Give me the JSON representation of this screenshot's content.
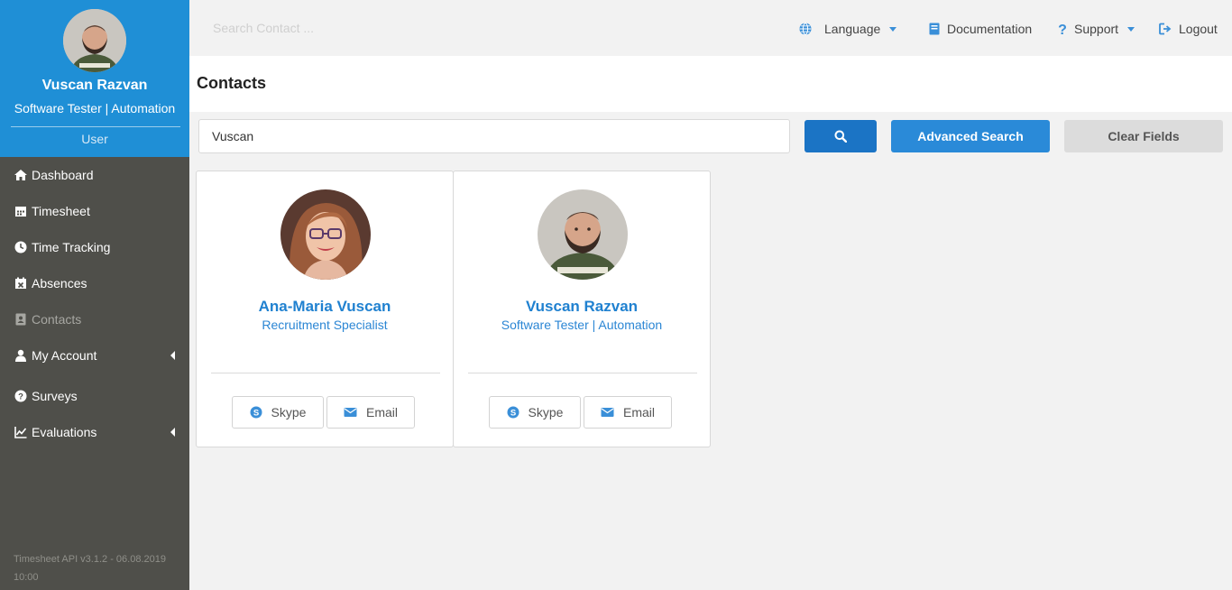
{
  "user": {
    "name": "Vuscan Razvan",
    "role": "Software Tester | Automation",
    "group": "User",
    "avatar": "avatar-man-beard"
  },
  "nav": [
    {
      "label": "Dashboard",
      "icon": "home-icon"
    },
    {
      "label": "Timesheet",
      "icon": "calendar-icon"
    },
    {
      "label": "Time Tracking",
      "icon": "clock-icon"
    },
    {
      "label": "Absences",
      "icon": "calendar-times-icon"
    },
    {
      "label": "Contacts",
      "icon": "address-book-icon",
      "active": true
    },
    {
      "label": "My Account",
      "icon": "user-icon",
      "has_submenu": true
    },
    {
      "label": "Surveys",
      "icon": "question-circle-icon"
    },
    {
      "label": "Evaluations",
      "icon": "line-chart-icon",
      "has_submenu": true
    }
  ],
  "version": "Timesheet API v3.1.2 - 06.08.2019 10:00",
  "topbar": {
    "search_placeholder": "Search Contact ...",
    "language": "Language",
    "documentation": "Documentation",
    "support": "Support",
    "logout": "Logout"
  },
  "page": {
    "title": "Contacts"
  },
  "search": {
    "value": "Vuscan",
    "search_icon": "search-icon",
    "advanced_label": "Advanced Search",
    "clear_label": "Clear Fields"
  },
  "contacts": [
    {
      "name": "Ana-Maria Vuscan",
      "title": "Recruitment Specialist",
      "skype_label": "Skype",
      "email_label": "Email",
      "photo": "woman-red-hair-glasses"
    },
    {
      "name": "Vuscan Razvan",
      "title": "Software Tester | Automation",
      "skype_label": "Skype",
      "email_label": "Email",
      "photo": "man-beard"
    }
  ],
  "colors": {
    "sidebar": "#4f4f4a",
    "profile_header": "#1f8fd6",
    "accent": "#2081d0",
    "search_button": "#1b74c5",
    "advanced_button": "#2a8ad8",
    "clear_button": "#dcdcdc"
  }
}
